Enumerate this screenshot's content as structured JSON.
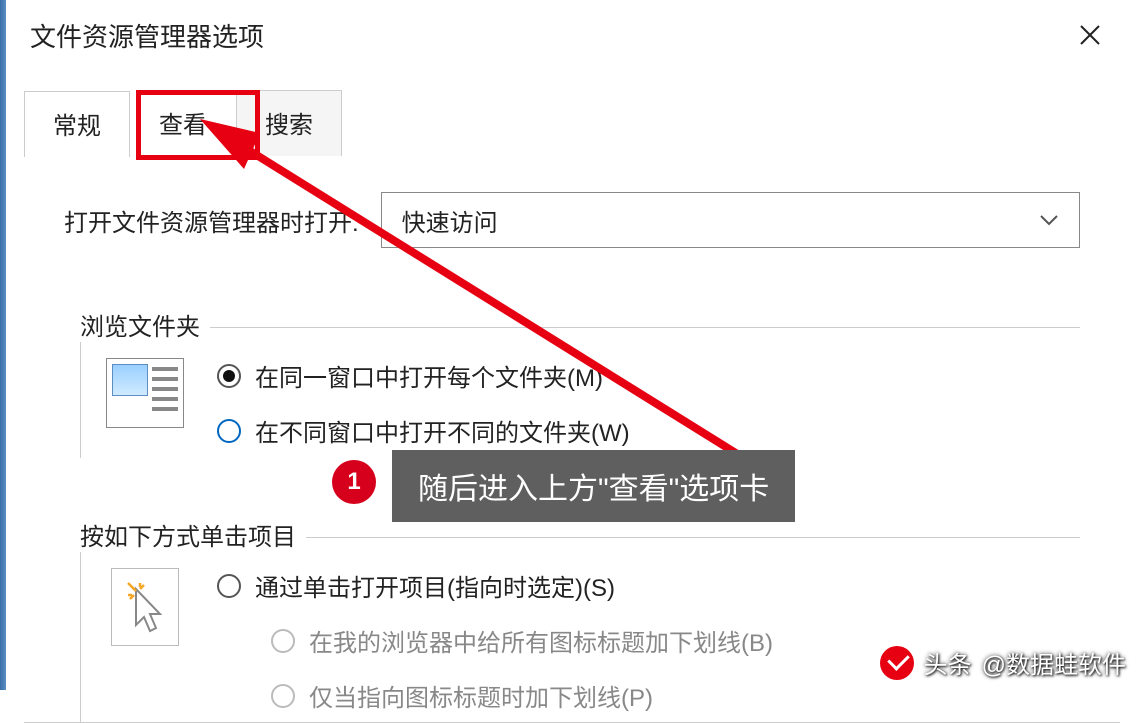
{
  "window": {
    "title": "文件资源管理器选项"
  },
  "tabs": {
    "general": "常规",
    "view": "查看",
    "search": "搜索"
  },
  "open_with": {
    "label": "打开文件资源管理器时打开:",
    "selected": "快速访问"
  },
  "browse_group": {
    "legend": "浏览文件夹",
    "opt_same": "在同一窗口中打开每个文件夹(M)",
    "opt_diff": "在不同窗口中打开不同的文件夹(W)"
  },
  "click_group": {
    "legend": "按如下方式单击项目",
    "opt_single": "通过单击打开项目(指向时选定)(S)",
    "opt_underline_all": "在我的浏览器中给所有图标标题加下划线(B)",
    "opt_underline_point": "仅当指向图标标题时加下划线(P)"
  },
  "annotation": {
    "badge": "1",
    "text": "随后进入上方\"查看\"选项卡"
  },
  "watermark": {
    "prefix": "头条",
    "text": "@数据蛙软件"
  }
}
